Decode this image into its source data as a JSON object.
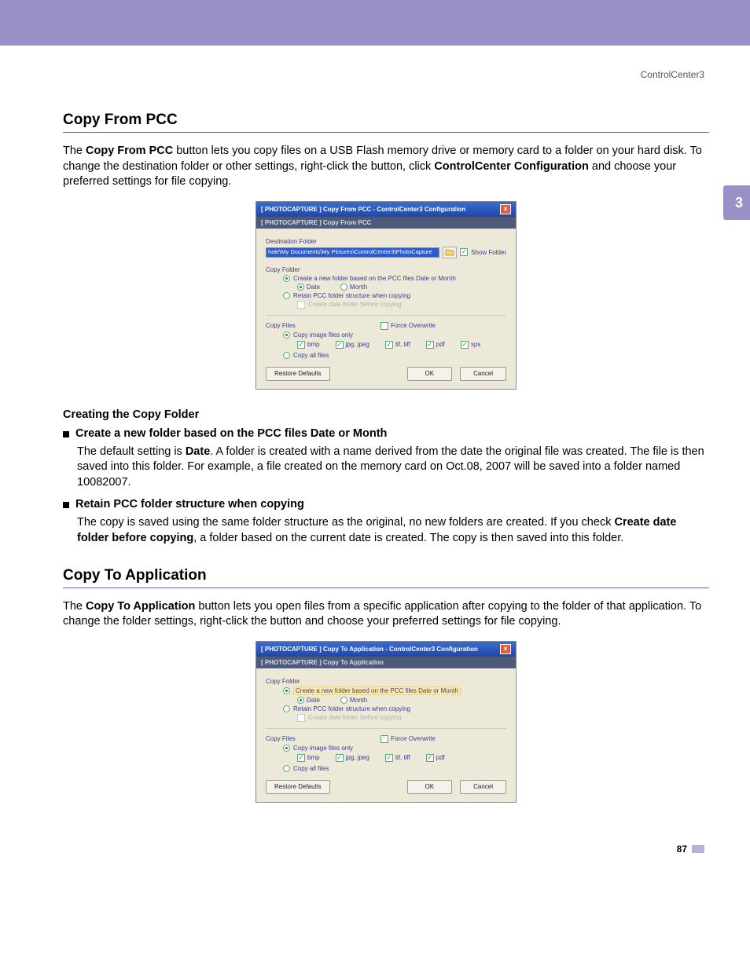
{
  "header": "ControlCenter3",
  "sideTab": "3",
  "pageNumber": "87",
  "section1": {
    "title": "Copy From PCC",
    "para_pre": "The ",
    "para_b1": "Copy From PCC",
    "para_mid": " button lets you copy files on a USB Flash memory drive or memory card to a folder on your hard disk. To change the destination folder or other settings, right-click the button, click ",
    "para_b2": "ControlCenter Configuration",
    "para_post": " and choose your preferred settings for file copying."
  },
  "dialog1": {
    "titlePrefix": "[ PHOTOCAPTURE ]  Copy From PCC - ControlCenter3 Configuration",
    "subTitle": "[ PHOTOCAPTURE ]   Copy From PCC",
    "destLabel": "Destination Folder",
    "destPath": "hale\\My Documents\\My Pictures\\ControlCenter3\\PhotoCapture",
    "showFolder": "Show Folder",
    "copyFolder": "Copy Folder",
    "optNewFolder": "Create a new folder based on the PCC files Date or Month",
    "date": "Date",
    "month": "Month",
    "optRetain": "Retain PCC folder structure when copying",
    "optCreateDate": "Create date folder before copying",
    "copyFiles": "Copy Files",
    "forceOverwrite": "Force Overwrite",
    "copyImageOnly": "Copy image files only",
    "bmp": "bmp",
    "jpg": "jpg, jpeg",
    "tif": "tif, tiff",
    "pdf": "pdf",
    "xps": "xps",
    "copyAll": "Copy all files",
    "restore": "Restore Defaults",
    "ok": "OK",
    "cancel": "Cancel"
  },
  "creating": {
    "heading": "Creating the Copy Folder",
    "b1": "Create a new folder based on the PCC files Date or Month",
    "p1a": "The default setting is ",
    "p1b": "Date",
    "p1c": ". A folder is created with a name derived from the date the original file was created. The file is then saved into this folder. For example, a file created on the memory card on Oct.08, 2007 will be saved into a folder named 10082007.",
    "b2": "Retain PCC folder structure when copying",
    "p2a": "The copy is saved using the same folder structure as the original, no new folders are created. If you check ",
    "p2b": "Create date folder before copying",
    "p2c": ", a folder based on the current date is created. The copy is then saved into this folder."
  },
  "section2": {
    "title": "Copy To Application",
    "para_pre": "The ",
    "para_b1": "Copy To Application",
    "para_post": " button lets you open files from a specific application after copying to the folder of that application. To change the folder settings, right-click the button and choose your preferred settings for file copying."
  },
  "dialog2": {
    "titlePrefix": "[ PHOTOCAPTURE ]  Copy To Application - ControlCenter3 Configuration",
    "subTitle": "[ PHOTOCAPTURE ]   Copy To Application"
  }
}
